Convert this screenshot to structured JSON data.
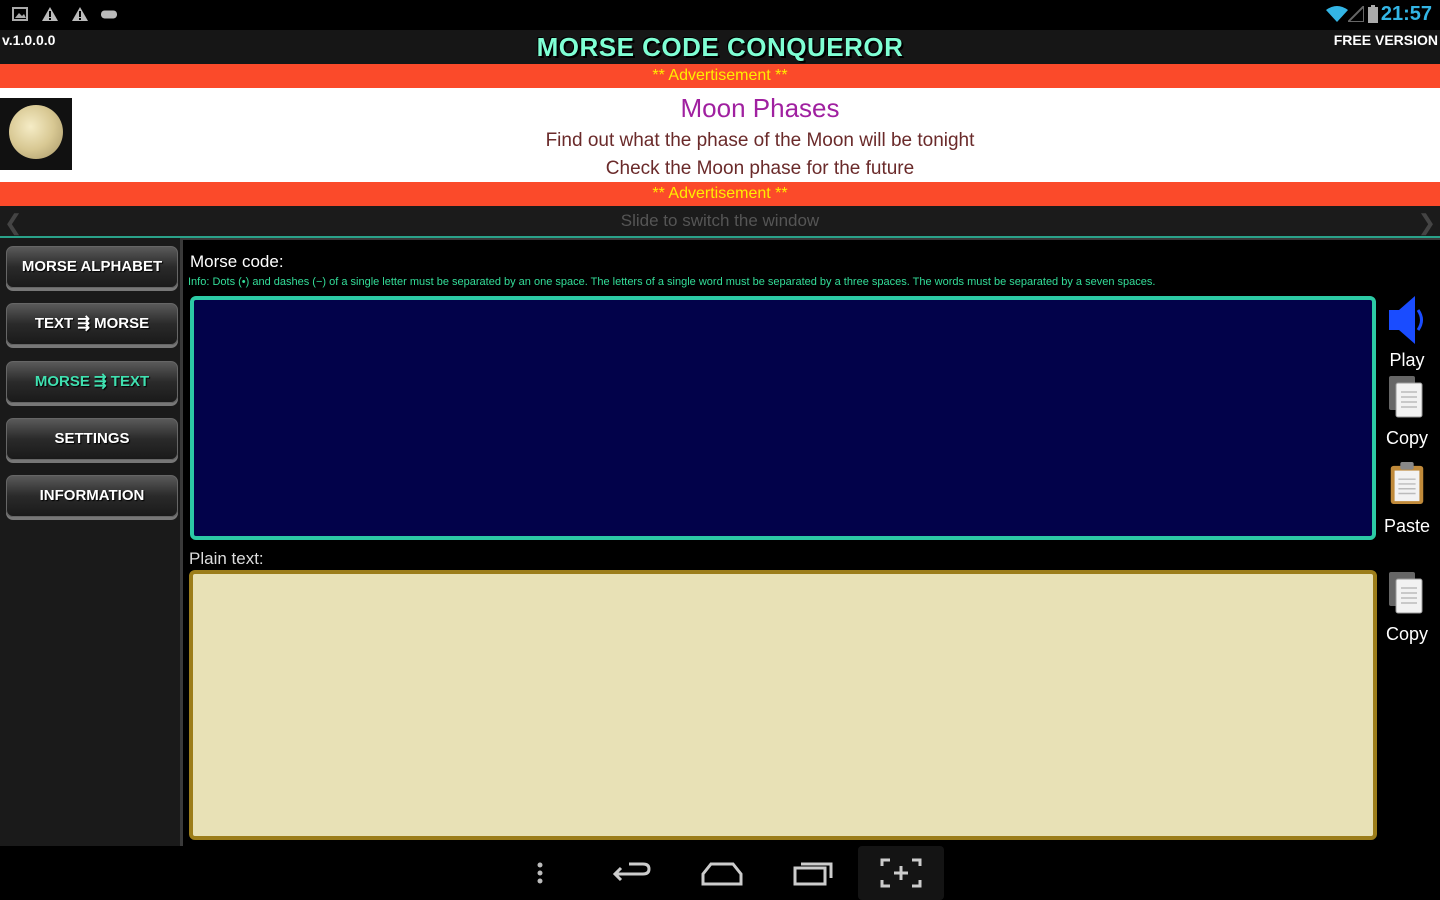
{
  "status_bar": {
    "time": "21:57",
    "left_icons": [
      "gallery-icon",
      "warning-icon",
      "warning-icon",
      "gamepad-icon"
    ],
    "right_icons": [
      "wifi-icon",
      "signal-icon",
      "battery-icon"
    ]
  },
  "header": {
    "version": "v.1.0.0.0",
    "title": "MORSE CODE CONQUEROR",
    "edition": "FREE VERSION"
  },
  "ad": {
    "banner_top": "** Advertisement **",
    "title": "Moon Phases",
    "line1": "Find out what the phase of the Moon will be tonight",
    "line2": "Check the Moon phase for the future",
    "banner_bottom": "** Advertisement **"
  },
  "slide_bar": {
    "text": "Slide to switch the window"
  },
  "sidebar": {
    "items": [
      {
        "label": "MORSE ALPHABET"
      },
      {
        "label": "TEXT ⇶ MORSE"
      },
      {
        "label": "MORSE ⇶ TEXT"
      },
      {
        "label": "SETTINGS"
      },
      {
        "label": "INFORMATION"
      }
    ],
    "active_index": 2
  },
  "main": {
    "morse_label": "Morse code:",
    "info": "Info: Dots (•) and dashes (−) of a single letter must be separated by an one space. The letters of a single word must be separated by a three spaces. The words must be separated by a seven spaces.",
    "morse_value": "",
    "plain_label": "Plain text:",
    "plain_value": ""
  },
  "controls": {
    "play_label": "Play",
    "copy_label": "Copy",
    "paste_label": "Paste",
    "copy2_label": "Copy"
  },
  "colors": {
    "accent": "#2ccaa5",
    "ad_banner": "#fb4a2a",
    "morse_box": "#02024a",
    "plain_box": "#e8e1b6",
    "time": "#33b5e5"
  }
}
